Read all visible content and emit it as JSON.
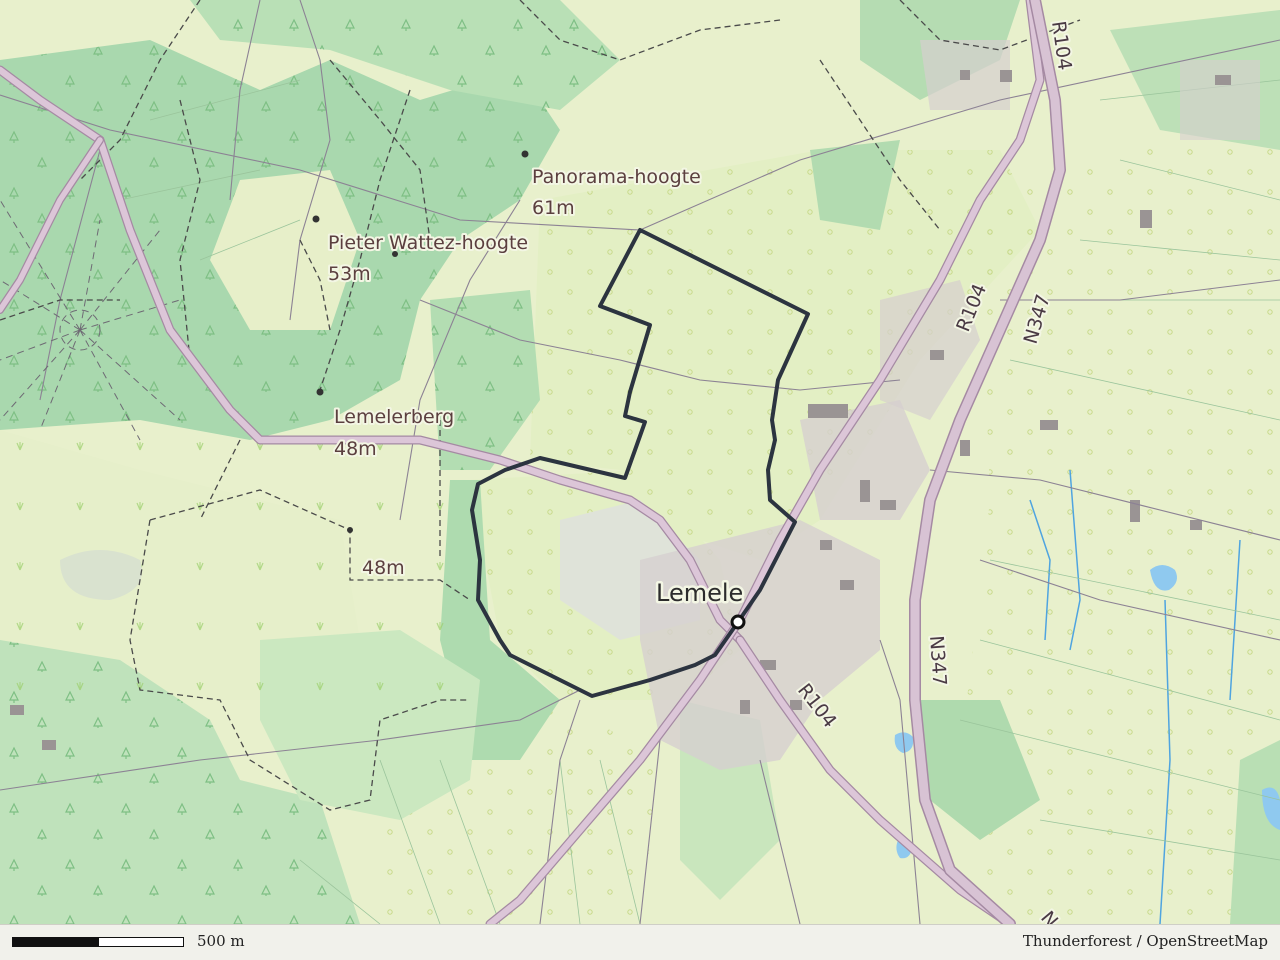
{
  "map": {
    "colors": {
      "background": "#eef2d6",
      "forest": "#a6d6ac",
      "forest_light": "#c3e5bd",
      "meadow": "#e3efc6",
      "road_fill": "#d9c4d4",
      "road_edge": "#a58aa3",
      "route": "#2c3440",
      "water": "#8cc8ee",
      "built": "#cfc9c9"
    },
    "places": {
      "town": "Lemele",
      "peaks": [
        {
          "name": "Panorama-hoogte",
          "elevation": "61m"
        },
        {
          "name": "Pieter Wattez-hoogte",
          "elevation": "53m"
        },
        {
          "name": "Lemelerberg",
          "elevation": "48m"
        }
      ],
      "spot_height": "48m"
    },
    "roads": {
      "r104_top": "R104",
      "r104_mid": "R104",
      "r104_bottom": "R104",
      "n347_top": "N347",
      "n347_mid": "N347",
      "n347_cut": "N"
    },
    "route": {
      "start_marker": "route-start"
    }
  },
  "footer": {
    "scale_label": "500 m",
    "attribution": "Thunderforest / OpenStreetMap"
  }
}
